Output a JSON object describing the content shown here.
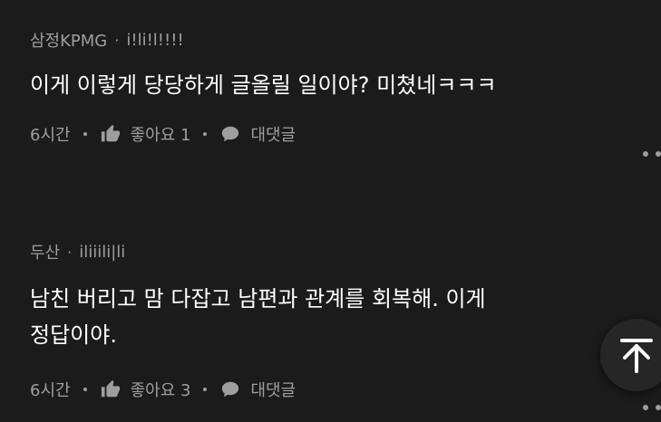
{
  "comments": [
    {
      "author": "삼정KPMG",
      "handle": "i!li!l!!!!",
      "text": "이게 이렇게 당당하게 글올릴 일이야? 미쳤네ㅋㅋㅋ",
      "time": "6시간",
      "likes_label": "좋아요 1",
      "reply_label": "대댓글"
    },
    {
      "author": "두산",
      "handle": "ilii​ili|li",
      "text": "남친 버리고 맘 다잡고 남편과 관계를 회복해. 이게\n정답이야.",
      "time": "6시간",
      "likes_label": "좋아요 3",
      "reply_label": "대댓글"
    }
  ],
  "separator": "·",
  "icons": {
    "like": "thumbs-up-icon",
    "reply": "speech-bubble-icon",
    "more": "more-options-icon",
    "scroll_top": "arrow-up-to-top-icon"
  },
  "colors": {
    "background": "#1b1b1b",
    "primary_text": "#ffffff",
    "secondary_text": "#9e9e9e",
    "fab": "#262626"
  }
}
